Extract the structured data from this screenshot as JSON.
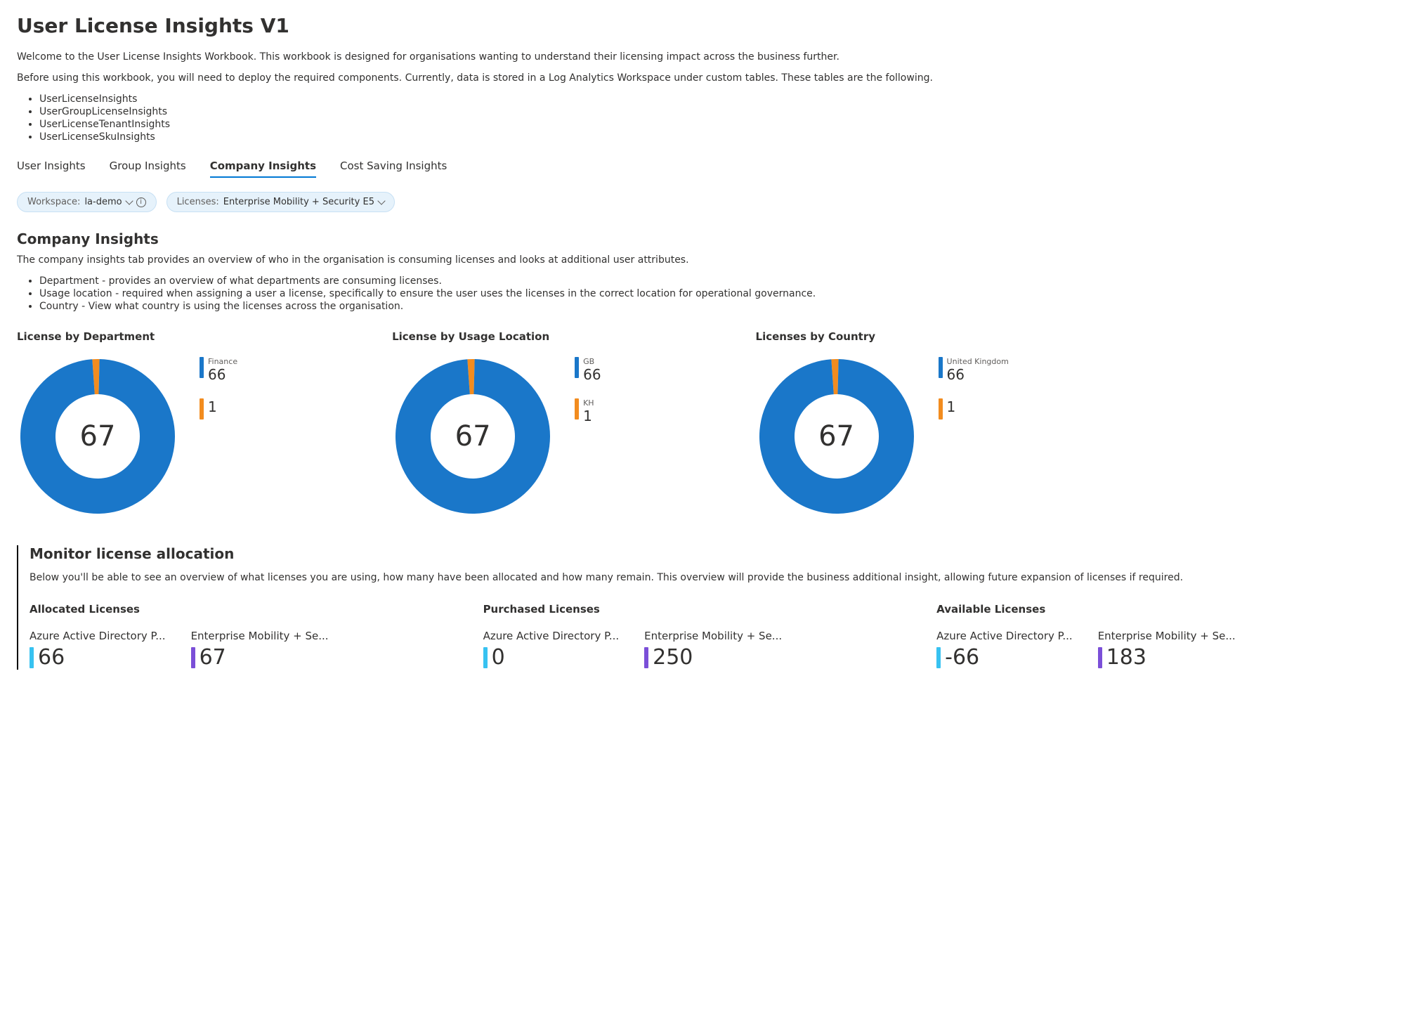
{
  "page_title": "User License Insights V1",
  "intro": {
    "p1": "Welcome to the User License Insights Workbook. This workbook is designed for organisations wanting to understand their licensing impact across the business further.",
    "p2": "Before using this workbook, you will need to deploy the required components. Currently, data is stored in a Log Analytics Workspace under custom tables. These tables are the following.",
    "tables": [
      "UserLicenseInsights",
      "UserGroupLicenseInsights",
      "UserLicenseTenantInsights",
      "UserLicenseSkuInsights"
    ]
  },
  "tabs": [
    "User Insights",
    "Group Insights",
    "Company Insights",
    "Cost Saving Insights"
  ],
  "active_tab_index": 2,
  "filters": {
    "workspace_label": "Workspace:",
    "workspace_value": "la-demo",
    "licenses_label": "Licenses:",
    "licenses_value": "Enterprise Mobility + Security E5"
  },
  "company": {
    "heading": "Company Insights",
    "desc": "The company insights tab provides an overview of who in the organisation is consuming licenses and looks at additional user attributes.",
    "bullets": [
      "Department - provides an overview of what departments are consuming licenses.",
      "Usage location - required when assigning a user a license, specifically to ensure the user uses the licenses in the correct location for operational governance.",
      "Country - View what country is using the licenses across the organisation."
    ]
  },
  "donuts": [
    {
      "title": "License by Department",
      "total": 67,
      "items": [
        {
          "label": "Finance",
          "value": 66,
          "color": "#1a77c9"
        },
        {
          "label": "",
          "value": 1,
          "color": "#f28c1f"
        }
      ]
    },
    {
      "title": "License by Usage Location",
      "total": 67,
      "items": [
        {
          "label": "GB",
          "value": 66,
          "color": "#1a77c9"
        },
        {
          "label": "KH",
          "value": 1,
          "color": "#f28c1f"
        }
      ]
    },
    {
      "title": "Licenses by Country",
      "total": 67,
      "items": [
        {
          "label": "United Kingdom",
          "value": 66,
          "color": "#1a77c9"
        },
        {
          "label": "",
          "value": 1,
          "color": "#f28c1f"
        }
      ]
    }
  ],
  "monitor": {
    "heading": "Monitor license allocation",
    "desc": "Below you'll be able to see an overview of what licenses you are using, how many have been allocated and how many remain. This overview will provide the business additional insight, allowing future expansion of licenses if required.",
    "groups": [
      {
        "title": "Allocated Licenses",
        "items": [
          {
            "label": "Azure Active Directory P...",
            "value": 66,
            "color": "#37c2f1"
          },
          {
            "label": "Enterprise Mobility + Se...",
            "value": 67,
            "color": "#7b4fd8"
          }
        ]
      },
      {
        "title": "Purchased Licenses",
        "items": [
          {
            "label": "Azure Active Directory P...",
            "value": 0,
            "color": "#37c2f1"
          },
          {
            "label": "Enterprise Mobility + Se...",
            "value": 250,
            "color": "#7b4fd8"
          }
        ]
      },
      {
        "title": "Available Licenses",
        "items": [
          {
            "label": "Azure Active Directory P...",
            "value": -66,
            "color": "#37c2f1"
          },
          {
            "label": "Enterprise Mobility + Se...",
            "value": 183,
            "color": "#7b4fd8"
          }
        ]
      }
    ]
  },
  "chart_data": [
    {
      "type": "pie",
      "title": "License by Department",
      "total": 67,
      "series": [
        {
          "name": "Finance",
          "value": 66
        },
        {
          "name": "(blank)",
          "value": 1
        }
      ]
    },
    {
      "type": "pie",
      "title": "License by Usage Location",
      "total": 67,
      "series": [
        {
          "name": "GB",
          "value": 66
        },
        {
          "name": "KH",
          "value": 1
        }
      ]
    },
    {
      "type": "pie",
      "title": "Licenses by Country",
      "total": 67,
      "series": [
        {
          "name": "United Kingdom",
          "value": 66
        },
        {
          "name": "(blank)",
          "value": 1
        }
      ]
    },
    {
      "type": "table",
      "title": "Allocated Licenses",
      "categories": [
        "Azure Active Directory P...",
        "Enterprise Mobility + Se..."
      ],
      "values": [
        66,
        67
      ]
    },
    {
      "type": "table",
      "title": "Purchased Licenses",
      "categories": [
        "Azure Active Directory P...",
        "Enterprise Mobility + Se..."
      ],
      "values": [
        0,
        250
      ]
    },
    {
      "type": "table",
      "title": "Available Licenses",
      "categories": [
        "Azure Active Directory P...",
        "Enterprise Mobility + Se..."
      ],
      "values": [
        -66,
        183
      ]
    }
  ]
}
